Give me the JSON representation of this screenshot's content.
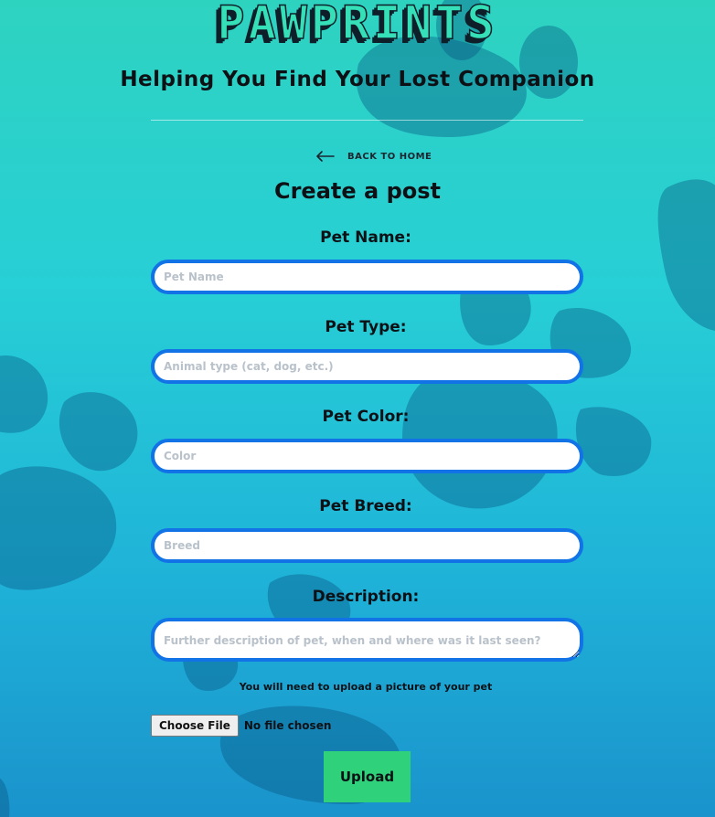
{
  "header": {
    "brand": "PAWPRINTS",
    "tagline": "Helping You Find Your Lost Companion"
  },
  "nav": {
    "back_label": "BACK TO HOME"
  },
  "form": {
    "title": "Create a post",
    "pet_name": {
      "label": "Pet Name:",
      "placeholder": "Pet Name",
      "value": ""
    },
    "pet_type": {
      "label": "Pet Type:",
      "placeholder": "Animal type (cat, dog, etc.)",
      "value": ""
    },
    "pet_color": {
      "label": "Pet Color:",
      "placeholder": "Color",
      "value": ""
    },
    "pet_breed": {
      "label": "Pet Breed:",
      "placeholder": "Breed",
      "value": ""
    },
    "description": {
      "label": "Description:",
      "placeholder": "Further description of pet, when and where was it last seen?",
      "value": ""
    },
    "upload_note": "You will need to upload a picture of your pet",
    "file": {
      "button_label": "Choose File",
      "status": "No file chosen"
    },
    "submit_label": "Upload"
  },
  "colors": {
    "field_border": "#1273e6",
    "submit_bg": "#2fd27a",
    "brand_fill": "#35e0b8",
    "paw_dark": "#0a5a8a"
  },
  "icons": {
    "back": "arrow-left-icon"
  }
}
